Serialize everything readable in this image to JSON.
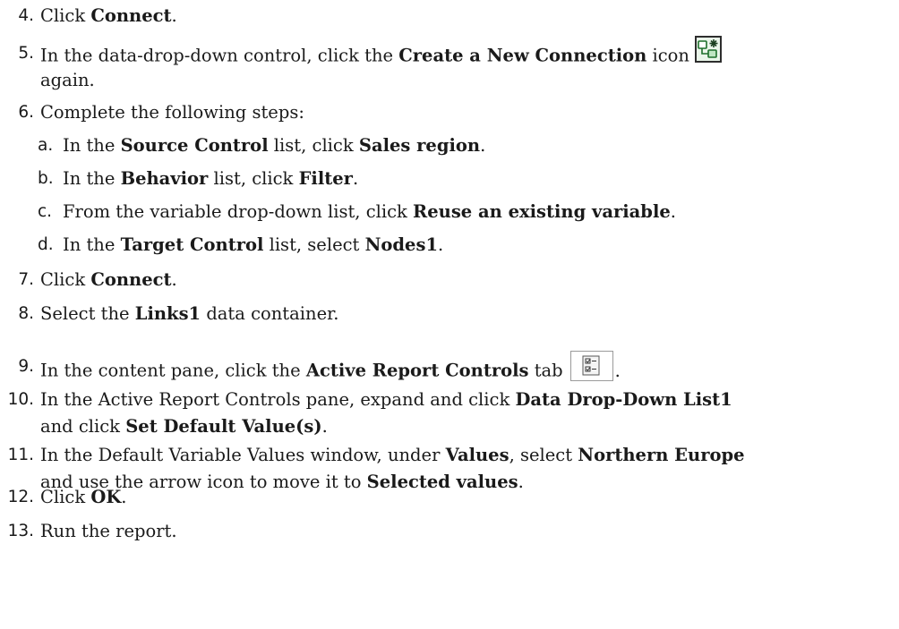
{
  "steps": [
    {
      "num": "4.",
      "parts": [
        {
          "t": "Click "
        },
        {
          "b": "Connect"
        },
        {
          "t": "."
        }
      ]
    },
    {
      "num": "5.",
      "parts": [
        {
          "t": "In the data-drop-down control, click the "
        },
        {
          "b": "Create a New Connection"
        },
        {
          "t": " icon"
        }
      ],
      "icon": "create-new-connection-icon",
      "cont": "again."
    },
    {
      "num": "6.",
      "parts": [
        {
          "t": "Complete the following steps:"
        }
      ]
    },
    {
      "num": "a.",
      "sub": true,
      "parts": [
        {
          "t": "In the "
        },
        {
          "b": "Source Control"
        },
        {
          "t": " list, click "
        },
        {
          "b": "Sales region"
        },
        {
          "t": "."
        }
      ]
    },
    {
      "num": "b.",
      "sub": true,
      "parts": [
        {
          "t": "In the "
        },
        {
          "b": "Behavior"
        },
        {
          "t": " list, click "
        },
        {
          "b": "Filter"
        },
        {
          "t": "."
        }
      ]
    },
    {
      "num": "c.",
      "sub": true,
      "parts": [
        {
          "t": "From the variable drop-down list, click "
        },
        {
          "b": "Reuse an existing variable"
        },
        {
          "t": "."
        }
      ]
    },
    {
      "num": "d.",
      "sub": true,
      "parts": [
        {
          "t": "In the "
        },
        {
          "b": "Target Control"
        },
        {
          "t": " list, select "
        },
        {
          "b": "Nodes1"
        },
        {
          "t": "."
        }
      ]
    },
    {
      "num": "7.",
      "parts": [
        {
          "t": "Click "
        },
        {
          "b": "Connect"
        },
        {
          "t": "."
        }
      ]
    },
    {
      "num": "8.",
      "parts": [
        {
          "t": "Select the "
        },
        {
          "b": "Links1"
        },
        {
          "t": " data container."
        }
      ]
    },
    {
      "num": "9.",
      "parts": [
        {
          "t": "In the content pane, click the "
        },
        {
          "b": "Active Report Controls"
        },
        {
          "t": " tab"
        }
      ],
      "icon": "active-report-controls-tab-icon",
      "after_icon": "."
    },
    {
      "num": "10.",
      "parts": [
        {
          "t": "In the Active Report Controls pane, expand and click "
        },
        {
          "b": "Data Drop-Down List1"
        }
      ],
      "cont_parts": [
        {
          "t": "and click "
        },
        {
          "b": "Set Default Value(s)"
        },
        {
          "t": "."
        }
      ]
    },
    {
      "num": "11.",
      "parts": [
        {
          "t": "In the Default Variable Values window, under "
        },
        {
          "b": "Values"
        },
        {
          "t": ", select "
        },
        {
          "b": "Northern Europe"
        }
      ],
      "cont_parts": [
        {
          "t": "and use the arrow icon to move it to "
        },
        {
          "b": "Selected values"
        },
        {
          "t": "."
        }
      ]
    },
    {
      "num": "12.",
      "parts": [
        {
          "t": "Click "
        },
        {
          "b": "OK"
        },
        {
          "t": "."
        }
      ]
    },
    {
      "num": "13.",
      "parts": [
        {
          "t": "Run the report."
        }
      ]
    }
  ]
}
